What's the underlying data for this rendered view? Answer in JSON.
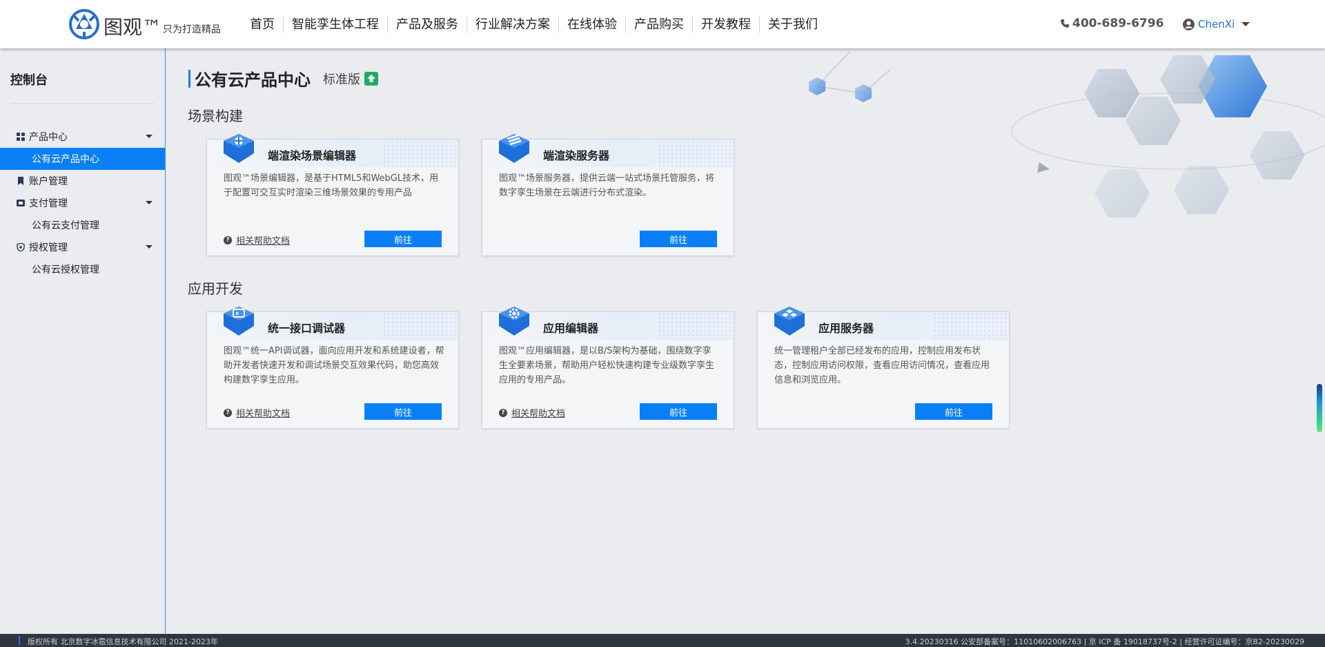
{
  "header": {
    "logo_name": "图观™",
    "logo_slogan": "只为打造精品",
    "nav": [
      "首页",
      "智能孪生体工程",
      "产品及服务",
      "行业解决方案",
      "在线体验",
      "产品购买",
      "开发教程",
      "关于我们"
    ],
    "phone": "400-689-6796",
    "user_name": "ChenXi"
  },
  "sidebar": {
    "title": "控制台",
    "groups": [
      {
        "label": "产品中心",
        "icon": "grid-icon",
        "sub": "公有云产品中心"
      },
      {
        "label": "账户管理",
        "icon": "bookmark-icon"
      },
      {
        "label": "支付管理",
        "icon": "wallet-icon",
        "sub": "公有云支付管理"
      },
      {
        "label": "授权管理",
        "icon": "shield-icon",
        "sub": "公有云授权管理"
      }
    ]
  },
  "main": {
    "page_title": "公有云产品中心",
    "edition": "标准版",
    "sections": [
      {
        "title": "场景构建",
        "cards": [
          {
            "title": "端渲染场景编辑器",
            "desc": "图观™场景编辑器，是基于HTML5和WebGL技术，用于配置可交互实时渲染三维场景效果的专用产品",
            "help": "相关帮助文档",
            "button": "前往",
            "icon": "scene-editor-icon"
          },
          {
            "title": "端渲染服务器",
            "desc": "图观™场景服务器，提供云端一站式场景托管服务，将数字孪生场景在云端进行分布式渲染。",
            "help": "",
            "button": "前往",
            "icon": "server-stack-icon"
          }
        ]
      },
      {
        "title": "应用开发",
        "cards": [
          {
            "title": "统一接口调试器",
            "desc": "图观™统一API调试器，面向应用开发和系统建设者，帮助开发者快速开发和调试场景交互效果代码，助您高效构建数字孪生应用。",
            "help": "相关帮助文档",
            "button": "前往",
            "icon": "api-debugger-icon"
          },
          {
            "title": "应用编辑器",
            "desc": "图观™应用编辑器，是以B/S架构为基础，围绕数字孪生全要素场景，帮助用户轻松快速构建专业级数字孪生应用的专用产品。",
            "help": "相关帮助文档",
            "button": "前往",
            "icon": "app-editor-gear-icon"
          },
          {
            "title": "应用服务器",
            "desc": "统一管理租户全部已经发布的应用，控制应用发布状态，控制应用访问权限，查看应用访问情况，查看应用信息和浏览应用。",
            "help": "",
            "button": "前往",
            "icon": "app-server-icon"
          }
        ]
      }
    ]
  },
  "footer": {
    "copyright": "版权所有 北京数字冰雹信息技术有限公司 2021-2023年",
    "icp": "3.4.20230316 公安部备案号：11010602006763 | 京 ICP 备 19018737号-2 | 经营许可证编号：京B2-20230029"
  },
  "colors": {
    "accent": "#0a7ff5",
    "upgrade": "#1aad62",
    "footer_bg": "#2f3640"
  }
}
